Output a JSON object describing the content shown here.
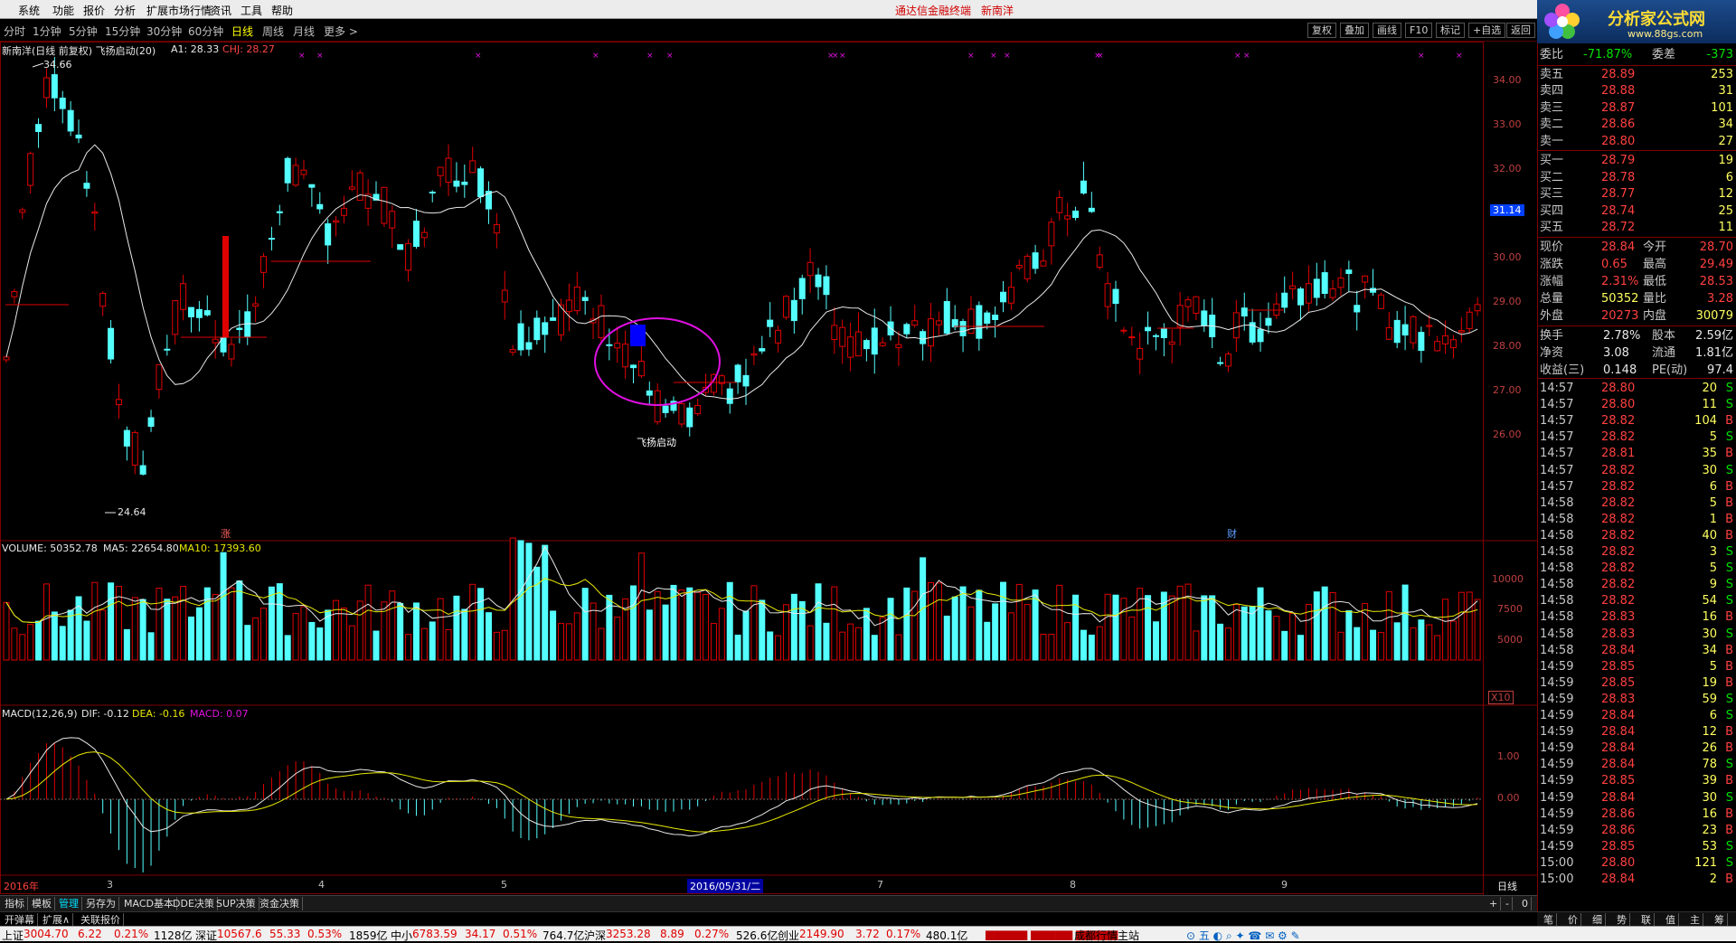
{
  "menu": [
    "系统",
    "功能",
    "报价",
    "分析",
    "扩展市场行情",
    "资讯",
    "工具",
    "帮助"
  ],
  "brand": "通达信金融终端",
  "stock_title": "新南洋",
  "logo": {
    "name": "分析家公式网",
    "url": "www.88gs.com"
  },
  "periods": [
    "分时",
    "1分钟",
    "5分钟",
    "15分钟",
    "30分钟",
    "60分钟",
    "日线",
    "周线",
    "月线",
    "更多 >"
  ],
  "active_period": "日线",
  "right_buttons": [
    "复权",
    "叠加",
    "画线",
    "F10",
    "标记",
    "+自选",
    "返回"
  ],
  "main_header": {
    "name": "新南洋(日线 前复权) 飞扬启动(20)",
    "a1": "A1: 28.33",
    "chj": "CHJ: 28.27"
  },
  "price_axis": [
    "34.00",
    "33.00",
    "32.00",
    "31.00",
    "30.00",
    "29.00",
    "28.00",
    "27.00",
    "26.00"
  ],
  "price_marker": "31.14",
  "high_label": "34.66",
  "low_label": "24.64",
  "signal_label": "飞扬启动",
  "event_labels": [
    "涨",
    "财"
  ],
  "volume_header": {
    "vol": "VOLUME: 50352.78",
    "ma5": "MA5: 22654.80",
    "ma10": "MA10: 17393.60"
  },
  "vol_axis": [
    "10000",
    "7500",
    "5000"
  ],
  "vol_unit": "X10",
  "macd_header": {
    "name": "MACD(12,26,9)",
    "dif": "DIF: -0.12",
    "dea": "DEA: -0.16",
    "macd": "MACD: 0.07"
  },
  "macd_axis": [
    "1.00",
    "0.00"
  ],
  "dates": [
    "2016年",
    "3",
    "4",
    "5",
    "2016/05/31/二",
    "7",
    "8",
    "9"
  ],
  "right_date_tab": "日线",
  "bottom_tabs": [
    "指标",
    "模板",
    "管理",
    "另存为",
    "MACD基本",
    "DDE决策",
    "SUP决策",
    "资金决策"
  ],
  "active_bottom_tab": "管理",
  "bottom_controls": [
    "+",
    "-",
    "0"
  ],
  "bottom_row2": [
    "开弹幕",
    "扩展∧",
    "关联报价"
  ],
  "quote": {
    "weibi": {
      "label": "委比",
      "value": "-71.87%",
      "c_label": "委差",
      "c_value": "-373"
    },
    "sell": [
      [
        "卖五",
        "28.89",
        "253"
      ],
      [
        "卖四",
        "28.88",
        "31"
      ],
      [
        "卖三",
        "28.87",
        "101"
      ],
      [
        "卖二",
        "28.86",
        "34"
      ],
      [
        "卖一",
        "28.80",
        "27"
      ]
    ],
    "buy": [
      [
        "买一",
        "28.79",
        "19"
      ],
      [
        "买二",
        "28.78",
        "6"
      ],
      [
        "买三",
        "28.77",
        "12"
      ],
      [
        "买四",
        "28.74",
        "25"
      ],
      [
        "买五",
        "28.72",
        "11"
      ]
    ],
    "stats": [
      [
        "现价",
        "28.84",
        "今开",
        "28.70"
      ],
      [
        "涨跌",
        "0.65",
        "最高",
        "29.49"
      ],
      [
        "涨幅",
        "2.31%",
        "最低",
        "28.53"
      ],
      [
        "总量",
        "50352",
        "量比",
        "3.28"
      ],
      [
        "外盘",
        "20273",
        "内盘",
        "30079"
      ]
    ],
    "stats2": [
      [
        "换手",
        "2.78%",
        "股本",
        "2.59亿"
      ],
      [
        "净资",
        "3.08",
        "流通",
        "1.81亿"
      ],
      [
        "收益(三)",
        "0.148",
        "PE(动)",
        "97.4"
      ]
    ]
  },
  "ticks": [
    [
      "14:57",
      "28.80",
      "20",
      "S"
    ],
    [
      "14:57",
      "28.80",
      "11",
      "S"
    ],
    [
      "14:57",
      "28.82",
      "104",
      "B"
    ],
    [
      "14:57",
      "28.82",
      "5",
      "S"
    ],
    [
      "14:57",
      "28.81",
      "35",
      "B"
    ],
    [
      "14:57",
      "28.82",
      "30",
      "S"
    ],
    [
      "14:57",
      "28.82",
      "6",
      "B"
    ],
    [
      "14:58",
      "28.82",
      "5",
      "B"
    ],
    [
      "14:58",
      "28.82",
      "1",
      "B"
    ],
    [
      "14:58",
      "28.82",
      "40",
      "B"
    ],
    [
      "14:58",
      "28.82",
      "3",
      "S"
    ],
    [
      "14:58",
      "28.82",
      "5",
      "S"
    ],
    [
      "14:58",
      "28.82",
      "9",
      "S"
    ],
    [
      "14:58",
      "28.82",
      "54",
      "S"
    ],
    [
      "14:58",
      "28.83",
      "16",
      "B"
    ],
    [
      "14:58",
      "28.83",
      "30",
      "S"
    ],
    [
      "14:58",
      "28.84",
      "34",
      "B"
    ],
    [
      "14:59",
      "28.85",
      "5",
      "B"
    ],
    [
      "14:59",
      "28.85",
      "19",
      "B"
    ],
    [
      "14:59",
      "28.83",
      "59",
      "S"
    ],
    [
      "14:59",
      "28.84",
      "6",
      "S"
    ],
    [
      "14:59",
      "28.84",
      "12",
      "B"
    ],
    [
      "14:59",
      "28.84",
      "26",
      "B"
    ],
    [
      "14:59",
      "28.84",
      "78",
      "S"
    ],
    [
      "14:59",
      "28.85",
      "39",
      "B"
    ],
    [
      "14:59",
      "28.84",
      "30",
      "S"
    ],
    [
      "14:59",
      "28.86",
      "16",
      "B"
    ],
    [
      "14:59",
      "28.86",
      "23",
      "B"
    ],
    [
      "14:59",
      "28.85",
      "53",
      "S"
    ],
    [
      "15:00",
      "28.80",
      "121",
      "S"
    ],
    [
      "15:00",
      "28.84",
      "2",
      "B"
    ]
  ],
  "rp_tabs": [
    "笔",
    "价",
    "细",
    "势",
    "联",
    "值",
    "主",
    "筹"
  ],
  "status": {
    "sh": [
      "上证",
      "3004.70",
      "6.22",
      "0.21%",
      "1128亿"
    ],
    "sz": [
      "深证",
      "10567.6",
      "55.33",
      "0.53%",
      "1859亿"
    ],
    "zx": [
      "中小",
      "6783.59",
      "34.17",
      "0.51%",
      "764.7亿"
    ],
    "hs": [
      "沪深",
      "3253.28",
      "8.89",
      "0.27%",
      "526.6亿"
    ],
    "cy": [
      "创业",
      "2149.90",
      "3.72",
      "0.17%",
      "480.1亿"
    ],
    "server": "成都行情主站"
  },
  "colors": {
    "up": "#e00000",
    "down": "#54ffff",
    "ma": "#e8e8e8",
    "dea": "#e8e800",
    "signal": "#0000ff",
    "circle": "#e010e0",
    "grid": "#800000"
  }
}
